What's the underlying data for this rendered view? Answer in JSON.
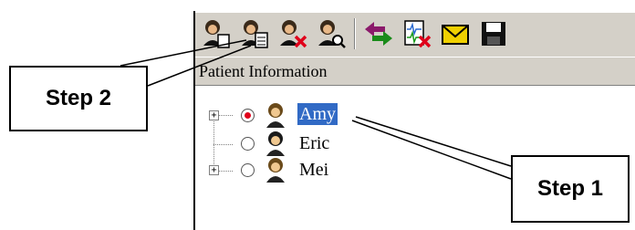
{
  "toolbar": {
    "buttons": [
      {
        "icon": "add-patient-icon"
      },
      {
        "icon": "edit-patient-icon"
      },
      {
        "icon": "delete-patient-icon"
      },
      {
        "icon": "find-patient-icon"
      },
      {
        "icon": "transfer-arrows-icon"
      },
      {
        "icon": "export-ecg-icon"
      },
      {
        "icon": "mail-icon"
      },
      {
        "icon": "save-disk-icon"
      }
    ]
  },
  "panel": {
    "header": "Patient Information"
  },
  "tree": {
    "patients": [
      {
        "name": "Amy",
        "selected": true,
        "expandable": true
      },
      {
        "name": "Eric",
        "selected": false,
        "expandable": false
      },
      {
        "name": "Mei",
        "selected": false,
        "expandable": true
      }
    ]
  },
  "callouts": {
    "step1": "Step 1",
    "step2": "Step 2"
  },
  "colors": {
    "toolbar_bg": "#d4d0c8",
    "selection": "#316ac5",
    "radio_on": "#e0001a",
    "delete_x": "#e0001a",
    "mail": "#f0d000"
  }
}
